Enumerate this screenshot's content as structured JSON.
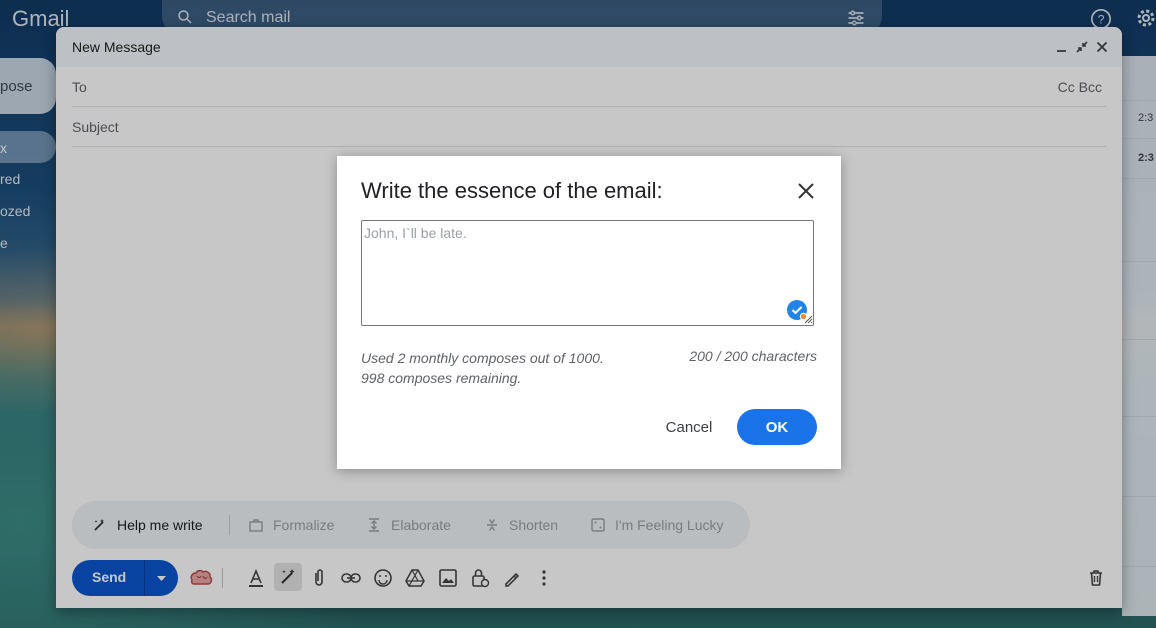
{
  "background": {
    "app_name": "Gmail",
    "search_placeholder": "Search mail",
    "compose_label": "pose",
    "nav_items": [
      "x",
      "red",
      "ozed",
      "e"
    ],
    "list_times": [
      "2:3",
      "2:3"
    ]
  },
  "compose": {
    "title": "New Message",
    "to_label": "To",
    "cc_bcc_label": "Cc Bcc",
    "subject_label": "Subject",
    "ai_toolbar": {
      "help_me_write": "Help me write",
      "formalize": "Formalize",
      "elaborate": "Elaborate",
      "shorten": "Shorten",
      "feeling_lucky": "I'm Feeling Lucky"
    },
    "send_label": "Send"
  },
  "dialog": {
    "title": "Write the essence of the email:",
    "placeholder": "John, I`ll be late.",
    "usage_line1": "Used 2 monthly composes out of 1000.",
    "usage_line2": "998 composes remaining.",
    "char_count": "200 / 200 characters",
    "cancel_label": "Cancel",
    "ok_label": "OK"
  },
  "colors": {
    "primary": "#1a73e8",
    "send": "#0b57d0",
    "header_bg": "#f2f6fc"
  }
}
